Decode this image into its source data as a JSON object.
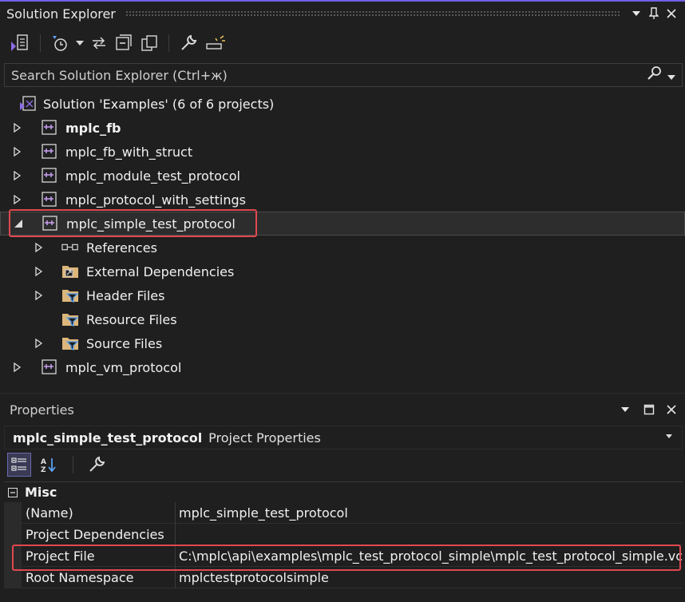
{
  "solution_explorer": {
    "title": "Solution Explorer",
    "search_placeholder": "Search Solution Explorer (Ctrl+ж)",
    "toolbar_icons": [
      "vs-switch-views-icon",
      "pending-changes-icon",
      "dropdown-arrow-icon",
      "sync-with-active-document-icon",
      "collapse-all-icon",
      "show-all-files-icon",
      "properties-wrench-icon",
      "preview-selected-icon"
    ],
    "solution_label": "Solution 'Examples' (6 of 6 projects)",
    "projects": [
      {
        "label": "mplc_fb",
        "bold": true
      },
      {
        "label": "mplc_fb_with_struct"
      },
      {
        "label": "mplc_module_test_protocol"
      },
      {
        "label": "mplc_protocol_with_settings"
      },
      {
        "label": "mplc_simple_test_protocol",
        "expanded": true,
        "selected": true
      },
      {
        "label": "mplc_vm_protocol"
      }
    ],
    "children": [
      {
        "label": "References",
        "icon": "references-icon"
      },
      {
        "label": "External Dependencies",
        "icon": "external-dependencies-folder-icon"
      },
      {
        "label": "Header Files",
        "icon": "filter-folder-icon"
      },
      {
        "label": "Resource Files",
        "icon": "filter-folder-icon"
      },
      {
        "label": "Source Files",
        "icon": "filter-folder-icon"
      }
    ]
  },
  "properties": {
    "title": "Properties",
    "object_name": "mplc_simple_test_protocol",
    "object_type": "Project Properties",
    "category": "Misc",
    "rows": [
      {
        "name": "(Name)",
        "value": "mplc_simple_test_protocol"
      },
      {
        "name": "Project Dependencies",
        "value": ""
      },
      {
        "name": "Project File",
        "value": "C:\\mplc\\api\\examples\\mplc_test_protocol_simple\\mplc_test_protocol_simple.vcxproj"
      },
      {
        "name": "Root Namespace",
        "value": "mplctestprotocolsimple"
      }
    ]
  },
  "colors": {
    "accent": "#7160e8",
    "highlight_box": "#e0484f",
    "project_icon": "#c9a0f0",
    "folder": "#dcb67a"
  }
}
